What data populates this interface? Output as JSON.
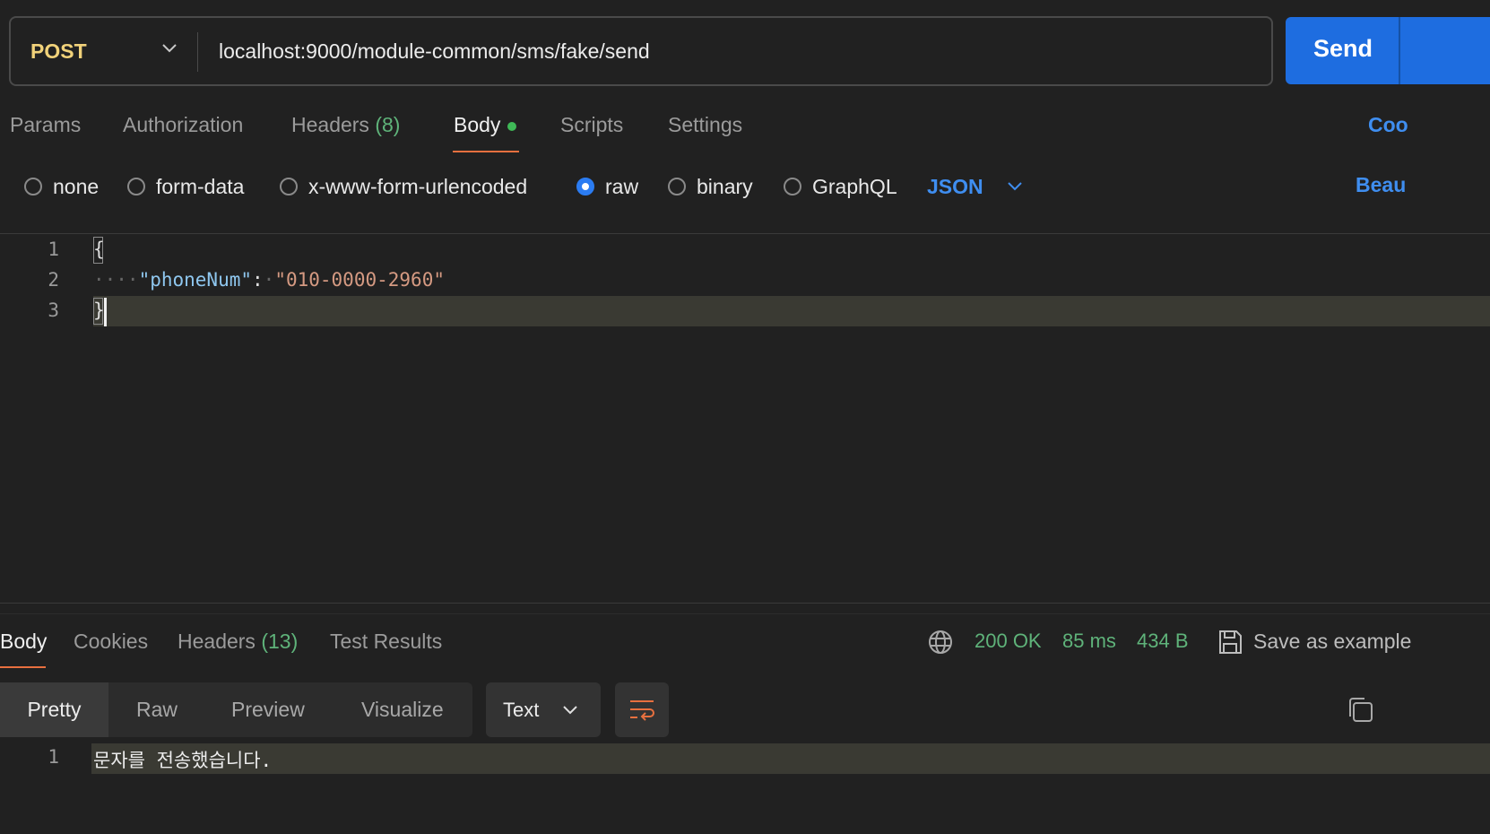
{
  "request": {
    "method": "POST",
    "url": "localhost:9000/module-common/sms/fake/send",
    "send_label": "Send"
  },
  "tabs": {
    "params": "Params",
    "authorization": "Authorization",
    "headers": "Headers",
    "headers_count": "(8)",
    "body": "Body",
    "scripts": "Scripts",
    "settings": "Settings",
    "cookies_link": "Coo"
  },
  "body_types": {
    "none": "none",
    "form_data": "form-data",
    "urlencoded": "x-www-form-urlencoded",
    "raw": "raw",
    "binary": "binary",
    "graphql": "GraphQL",
    "selected": "raw",
    "format": "JSON",
    "beautify_link": "Beau"
  },
  "editor": {
    "line_numbers": [
      "1",
      "2",
      "3"
    ],
    "open_brace": "{",
    "key": "\"phoneNum\"",
    "colon": ":",
    "value": "\"010-0000-2960\"",
    "close_brace": "}"
  },
  "response": {
    "tabs": {
      "body": "Body",
      "cookies": "Cookies",
      "headers": "Headers",
      "headers_count": "(13)",
      "test_results": "Test Results"
    },
    "status": "200 OK",
    "time": "85 ms",
    "size": "434 B",
    "save_as_example": "Save as example",
    "views": {
      "pretty": "Pretty",
      "raw": "Raw",
      "preview": "Preview",
      "visualize": "Visualize"
    },
    "format": "Text",
    "line_number": "1",
    "content": "문자를 전송했습니다."
  },
  "colors": {
    "accent_blue": "#1e6de0",
    "tab_underline": "#e8703f",
    "status_green": "#5fb37a",
    "method_yellow": "#f1d27a"
  }
}
